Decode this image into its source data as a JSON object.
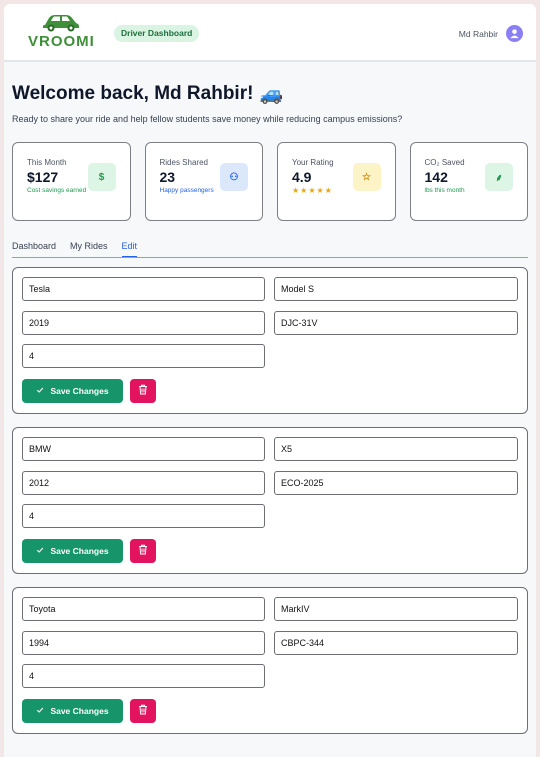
{
  "header": {
    "logo_text": "VROOMI",
    "badge": "Driver Dashboard",
    "user_name": "Md Rahbir"
  },
  "welcome": {
    "title": "Welcome back, Md Rahbir!",
    "emoji": "🚙",
    "subtitle": "Ready to share your ride and help fellow students save money while reducing campus emissions?"
  },
  "stats": [
    {
      "label": "This Month",
      "value": "$127",
      "sub": "Cost savings earned",
      "icon": "dollar-icon",
      "glyph": "$",
      "color": "#1f9a52",
      "bg": "#dcf5e4"
    },
    {
      "label": "Rides Shared",
      "value": "23",
      "sub": "Happy passengers",
      "icon": "group-icon",
      "glyph": "⚇",
      "color": "#2563eb",
      "bg": "#dbe8fb"
    },
    {
      "label": "Your Rating",
      "value": "4.9",
      "stars": "★★★★★",
      "icon": "star-icon",
      "glyph": "☆",
      "color": "#c98a0c",
      "bg": "#fcf3c6"
    },
    {
      "label": "CO₂ Saved",
      "value": "142",
      "sub": "lbs this month",
      "icon": "leaf-icon",
      "glyph": "⸙",
      "color": "#1f9a52",
      "bg": "#dcf5e4"
    }
  ],
  "tabs": [
    "Dashboard",
    "My Rides",
    "Edit"
  ],
  "active_tab": "Edit",
  "vehicles": [
    {
      "make": "Tesla",
      "model": "Model S",
      "year": "2019",
      "plate": "DJC-31V",
      "seats": "4"
    },
    {
      "make": "BMW",
      "model": "X5",
      "year": "2012",
      "plate": "ECO-2025",
      "seats": "4"
    },
    {
      "make": "Toyota",
      "model": "MarkIV",
      "year": "1994",
      "plate": "CBPC-344",
      "seats": "4"
    }
  ],
  "save_label": "Save Changes",
  "colors": {
    "primary": "#16956b",
    "danger": "#e2145f",
    "accent": "#2563eb",
    "brand": "#3f8f3a"
  }
}
